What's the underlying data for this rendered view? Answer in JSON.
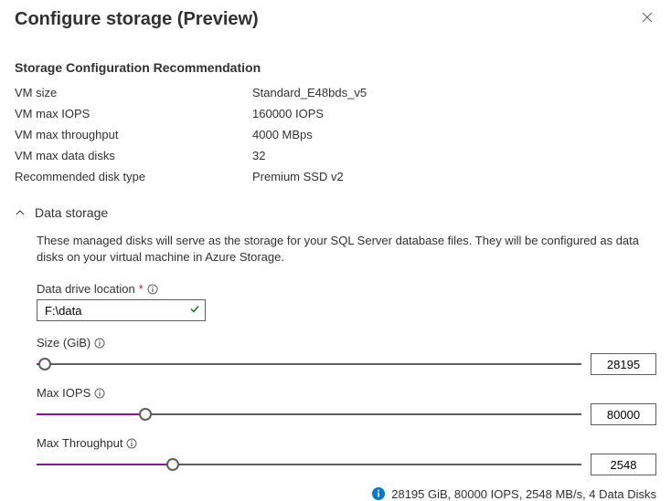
{
  "header": {
    "title": "Configure storage (Preview)"
  },
  "recommendation": {
    "section_title": "Storage Configuration Recommendation",
    "rows": [
      {
        "label": "VM size",
        "value": "Standard_E48bds_v5"
      },
      {
        "label": "VM max IOPS",
        "value": "160000 IOPS"
      },
      {
        "label": "VM max throughput",
        "value": "4000 MBps"
      },
      {
        "label": "VM max data disks",
        "value": "32"
      },
      {
        "label": "Recommended disk type",
        "value": "Premium SSD v2"
      }
    ]
  },
  "data_storage": {
    "title": "Data storage",
    "description": "These managed disks will serve as the storage for your SQL Server database files. They will be configured as data disks on your virtual machine in Azure Storage.",
    "drive_location": {
      "label": "Data drive location",
      "value": "F:\\data"
    },
    "size": {
      "label": "Size (GiB)",
      "value": "28195",
      "fill_pct": 1.5
    },
    "max_iops": {
      "label": "Max IOPS",
      "value": "80000",
      "fill_pct": 20
    },
    "max_throughput": {
      "label": "Max Throughput",
      "value": "2548",
      "fill_pct": 25
    },
    "summary": "28195 GiB, 80000 IOPS, 2548 MB/s, 4 Data Disks"
  }
}
